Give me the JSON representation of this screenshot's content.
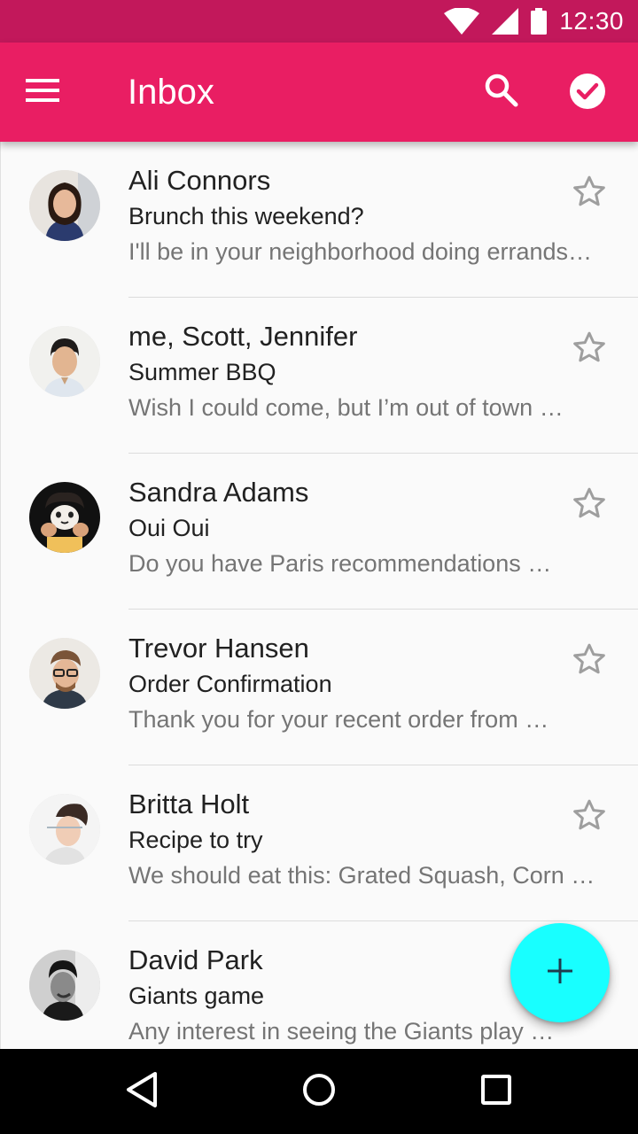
{
  "status_bar": {
    "time": "12:30",
    "icons": [
      "wifi-icon",
      "cell-signal-icon",
      "battery-icon"
    ],
    "color": "#C2185B"
  },
  "app_bar": {
    "title": "Inbox",
    "color": "#E91E63",
    "icons": [
      "menu-icon",
      "search-icon",
      "check-circle-icon"
    ]
  },
  "messages": [
    {
      "sender": "Ali Connors",
      "subject": "Brunch this weekend?",
      "preview": "I'll be in your neighborhood doing errands…",
      "starred": false
    },
    {
      "sender": "me, Scott, Jennifer",
      "subject": "Summer BBQ",
      "preview": "Wish I could come, but I’m out of town …",
      "starred": false
    },
    {
      "sender": "Sandra Adams",
      "subject": "Oui Oui",
      "preview": "Do you have Paris recommendations …",
      "starred": false
    },
    {
      "sender": "Trevor Hansen",
      "subject": "Order Confirmation",
      "preview": "Thank you for your recent order from …",
      "starred": false
    },
    {
      "sender": "Britta Holt",
      "subject": "Recipe to try",
      "preview": "We should eat this: Grated Squash, Corn …",
      "starred": false
    },
    {
      "sender": "David Park",
      "subject": "Giants game",
      "preview": "Any interest in seeing the Giants play …",
      "starred": false
    }
  ],
  "fab": {
    "icon": "add-icon",
    "color": "#18FFFF"
  },
  "nav_bar": {
    "icons": [
      "back-icon",
      "home-icon",
      "recents-icon"
    ]
  }
}
